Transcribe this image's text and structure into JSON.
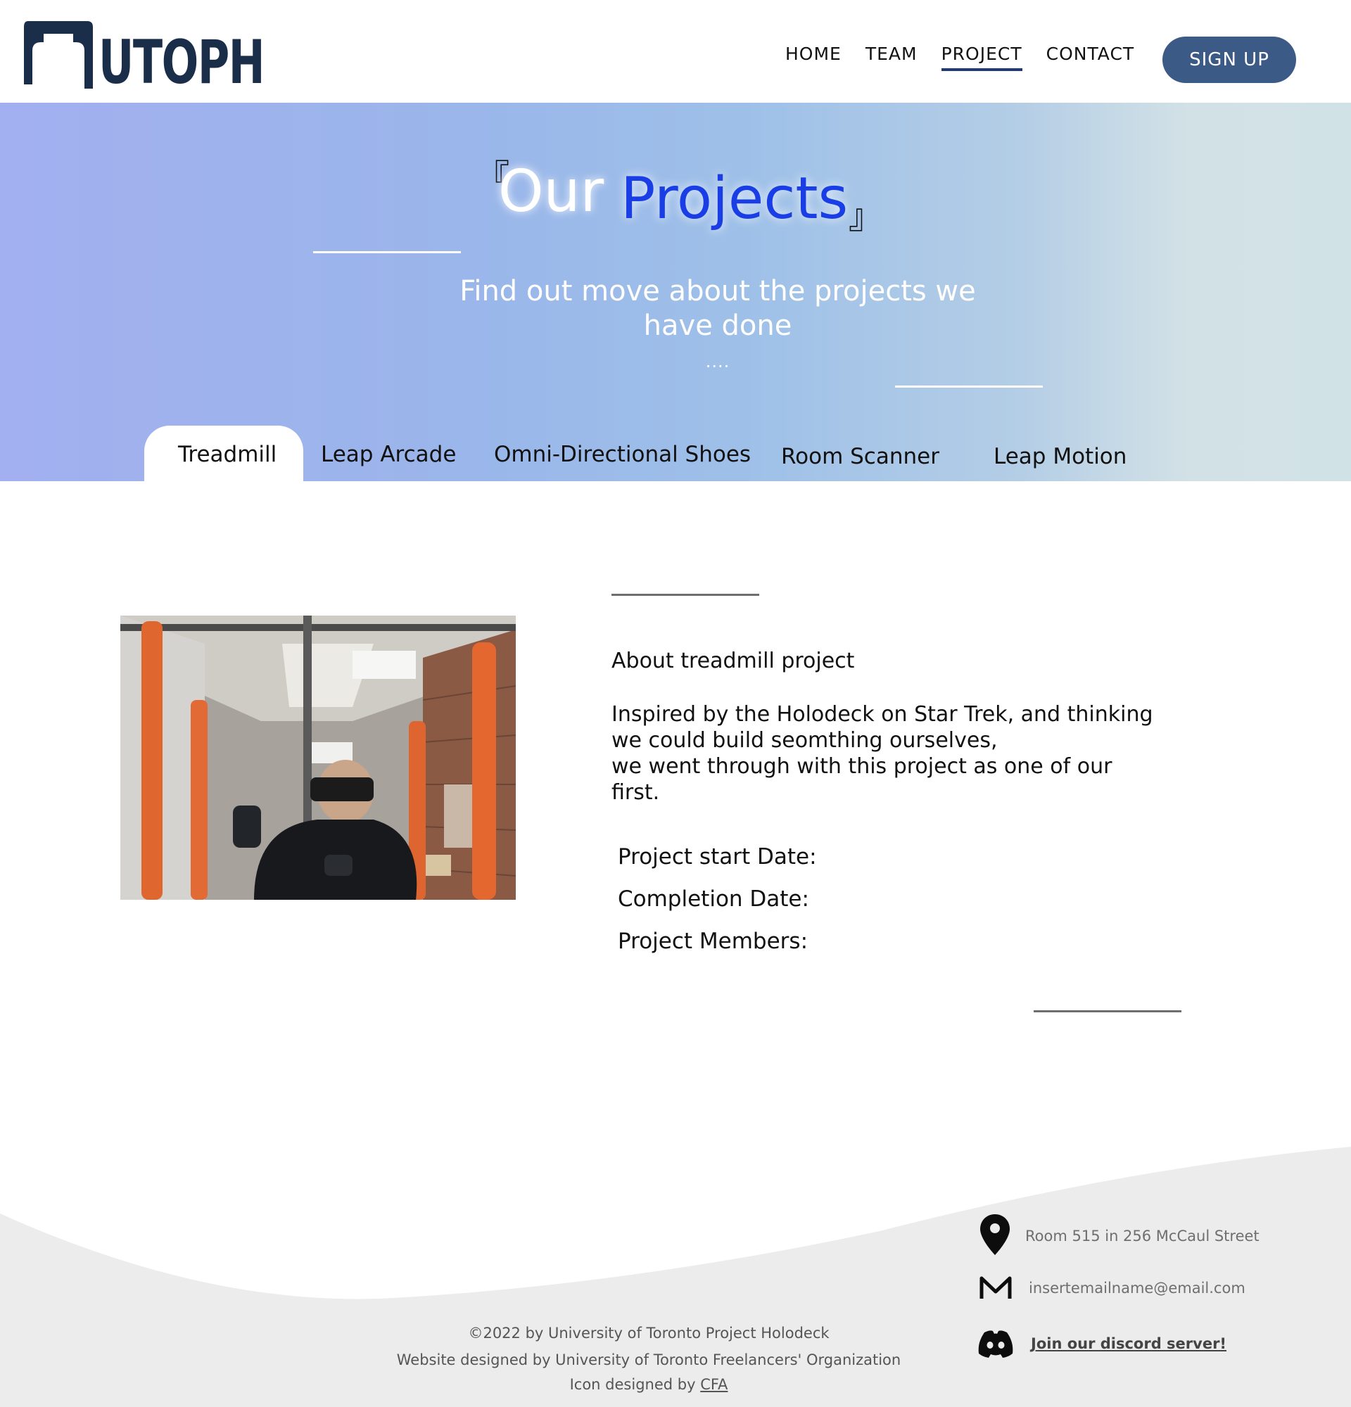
{
  "header": {
    "logo_text": "UTOPH",
    "nav": [
      {
        "label": "HOME"
      },
      {
        "label": "TEAM"
      },
      {
        "label": "PROJECT"
      },
      {
        "label": "CONTACT"
      }
    ],
    "signup_label": "SIGN UP",
    "active_nav": "PROJECT"
  },
  "hero": {
    "bracket_open": "『",
    "bracket_close": "』",
    "title_part1": "Our",
    "title_part2": "Projects",
    "subtitle": "Find out move about the projects we have done",
    "dots": "....",
    "title_color": "#1a3ee6"
  },
  "tabs": [
    {
      "label": "Treadmill",
      "active": true
    },
    {
      "label": "Leap Arcade"
    },
    {
      "label": "Omni-Directional Shoes"
    },
    {
      "label": "Room Scanner"
    },
    {
      "label": "Leap Motion"
    }
  ],
  "project": {
    "about_title": "About treadmill project",
    "about_lines": [
      "Inspired by the Holodeck on Star Trek, and thinking",
      "we could build seomthing ourselves,",
      "we went through with this project as one of our",
      "first."
    ],
    "start_date_label": "Project start Date:",
    "completion_date_label": "Completion Date:",
    "members_label": "Project Members:"
  },
  "footer": {
    "address": "Room 515 in 256 McCaul Street",
    "email": "insertemailname@email.com",
    "discord": "Join our discord server!",
    "copyright": "©2022 by University of Toronto Project Holodeck",
    "designed_by": "Website designed by University of Toronto Freelancers' Organization",
    "icon_credit_prefix": "Icon designed by",
    "icon_credit_link": "CFA"
  },
  "colors": {
    "brand_dark": "#1a2e4a",
    "signup_bg": "#3b5a85",
    "nav_underline": "#1e3a7a",
    "footer_bg": "#ececec"
  }
}
